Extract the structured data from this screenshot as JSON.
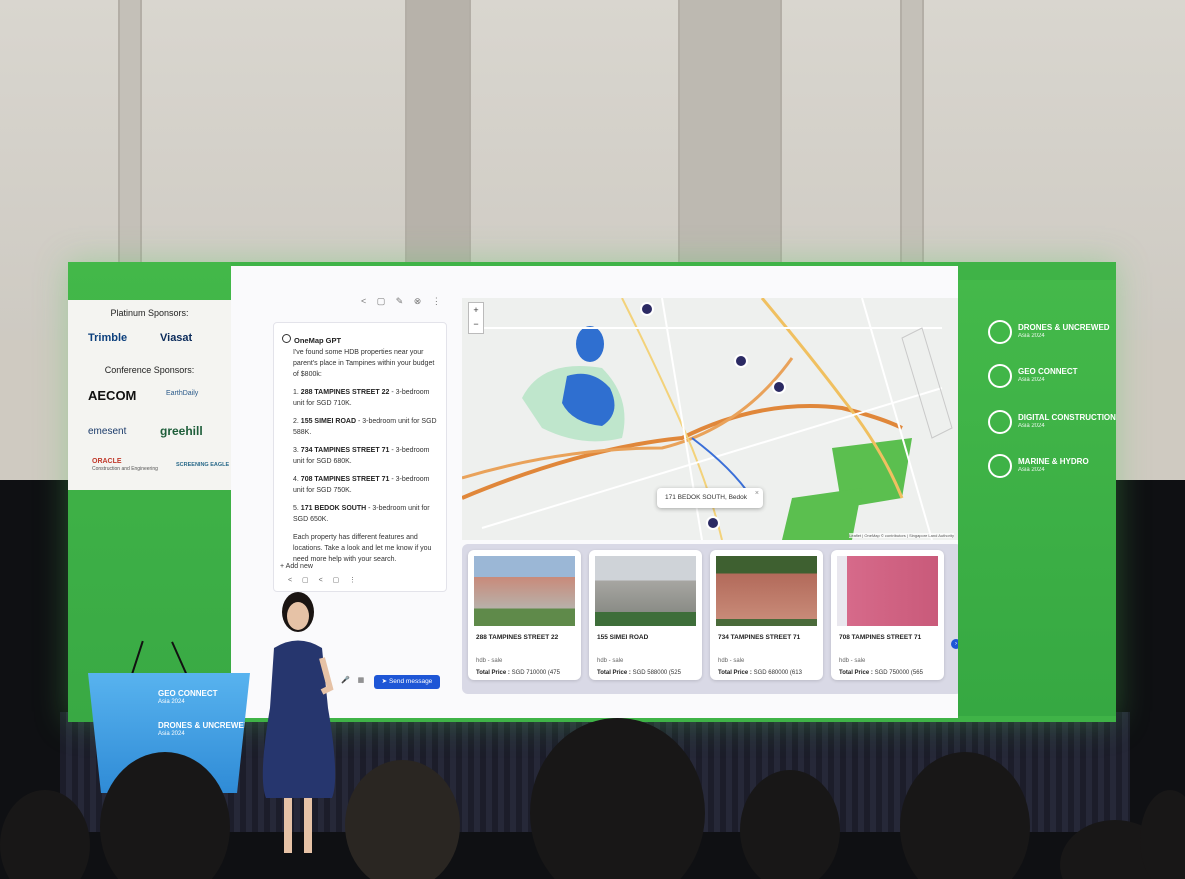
{
  "sponsors": {
    "platinum_heading": "Platinum Sponsors:",
    "platinum": [
      "Trimble",
      "Viasat"
    ],
    "conference_heading": "Conference Sponsors:",
    "conference": [
      "AECOM",
      "EarthDaily",
      "emesent",
      "greehill",
      "ORACLE",
      "Construction and Engineering",
      "SCREENING EAGLE"
    ]
  },
  "events": [
    {
      "name": "DRONES & UNCREWED",
      "sub": "Asia 2024"
    },
    {
      "name": "GEO CONNECT",
      "sub": "Asia 2024"
    },
    {
      "name": "DIGITAL CONSTRUCTION",
      "sub": "Asia 2024"
    },
    {
      "name": "MARINE & HYDRO",
      "sub": "Asia 2024"
    }
  ],
  "chat": {
    "assistant_name": "OneMap GPT",
    "intro": "I've found some HDB properties near your parent's place in Tampines within your budget of $800k:",
    "items": [
      {
        "n": "1.",
        "name": "288 TAMPINES STREET 22",
        "desc": "- 3-bedroom unit for SGD 710K."
      },
      {
        "n": "2.",
        "name": "155 SIMEI ROAD",
        "desc": "- 3-bedroom unit for SGD 588K."
      },
      {
        "n": "3.",
        "name": "734 TAMPINES STREET 71",
        "desc": "- 3-bedroom unit for SGD 680K."
      },
      {
        "n": "4.",
        "name": "708 TAMPINES STREET 71",
        "desc": "- 3-bedroom unit for SGD 750K."
      },
      {
        "n": "5.",
        "name": "171 BEDOK SOUTH",
        "desc": "- 3-bedroom unit for SGD 650K."
      }
    ],
    "outro": "Each property has different features and locations. Take a look and let me know if you need more help with your search.",
    "add_new": "+ Add new",
    "send_label": "Send message"
  },
  "map": {
    "popup": "171 BEDOK SOUTH, Bedok",
    "zoom_in": "+",
    "zoom_out": "−",
    "attribution": "Leaflet | OneMap © contributors | Singapore Land Authority"
  },
  "cards": [
    {
      "title": "288 TAMPINES STREET 22",
      "type": "hdb - sale",
      "price_label": "Total Price :",
      "price": "SGD 710000 (475"
    },
    {
      "title": "155 SIMEI ROAD",
      "type": "hdb - sale",
      "price_label": "Total Price :",
      "price": "SGD 588000 (525"
    },
    {
      "title": "734 TAMPINES STREET 71",
      "type": "hdb - sale",
      "price_label": "Total Price :",
      "price": "SGD 680000 (613"
    },
    {
      "title": "708 TAMPINES STREET 71",
      "type": "hdb - sale",
      "price_label": "Total Price :",
      "price": "SGD 750000 (565"
    }
  ],
  "podium": {
    "line1": "GEO CONNECT",
    "line1_sub": "Asia 2024",
    "line2": "DRONES & UNCREWED",
    "line2_sub": "Asia 2024"
  },
  "colors": {
    "screen_green": "#3fb347",
    "send_blue": "#1e56d6",
    "pin": "#2b2a63"
  }
}
